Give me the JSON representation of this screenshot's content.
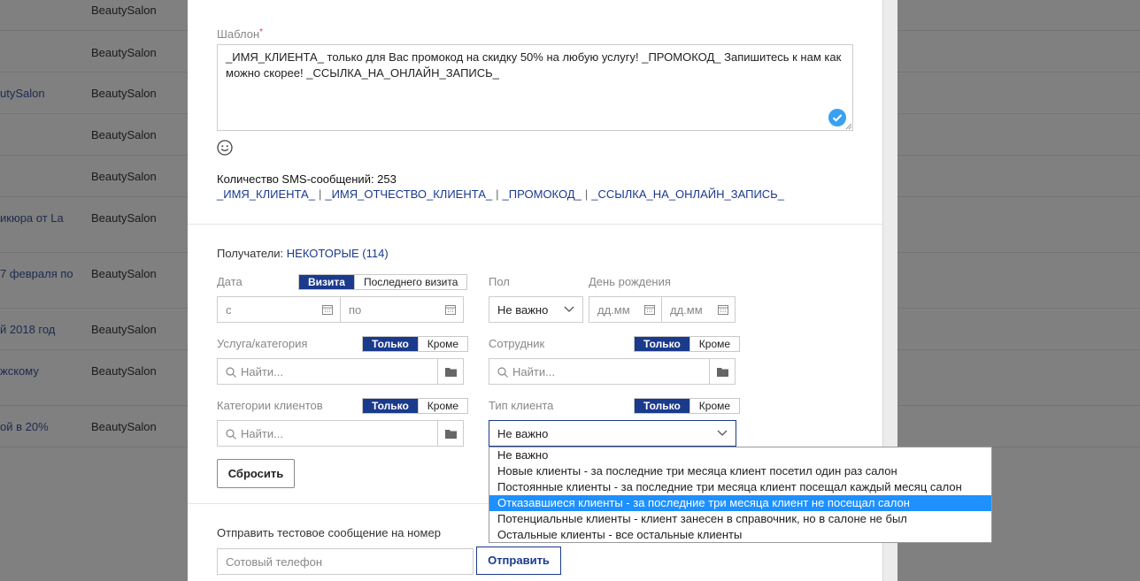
{
  "background_list": {
    "rows": [
      {
        "name": "",
        "salon": "BeautySalon"
      },
      {
        "name": "",
        "salon": "BeautySalon"
      },
      {
        "name": "utySalon",
        "salon": "BeautySalon"
      },
      {
        "name": "",
        "salon": "BeautySalon"
      },
      {
        "name": "",
        "salon": "BeautySalon"
      },
      {
        "name": "икюра от La",
        "salon": "BeautySalon"
      },
      {
        "name": "7 февраля по",
        "salon": "BeautySalon"
      },
      {
        "name": "й 2018 год",
        "salon": "BeautySalon"
      },
      {
        "name": "жскому",
        "salon": "BeautySalon"
      },
      {
        "name": "ой в 20%",
        "salon": "BeautySalon"
      }
    ]
  },
  "template": {
    "label": "Шаблон",
    "text": "_ИМЯ_КЛИЕНТА_ только для Вас промокод на скидку 50% на любую услугу! _ПРОМОКОД_ Запишитесь к нам как можно скорее! _ССЫЛКА_НА_ОНЛАЙН_ЗАПИСЬ_",
    "sms_count": "Количество SMS-сообщений: 253",
    "variables": [
      "_ИМЯ_КЛИЕНТА_",
      "_ИМЯ_ОТЧЕСТВО_КЛИЕНТА_",
      "_ПРОМОКОД_",
      "_ССЫЛКА_НА_ОНЛАЙН_ЗАПИСЬ_"
    ],
    "separator": "|"
  },
  "recipients": {
    "label": "Получатели:",
    "value": "НЕКОТОРЫЕ (114)"
  },
  "filters": {
    "date": {
      "label": "Дата",
      "toggle": [
        "Визита",
        "Последнего визита"
      ],
      "from_placeholder": "с",
      "to_placeholder": "по"
    },
    "gender": {
      "label": "Пол",
      "value": "Не важно"
    },
    "birthday": {
      "label": "День рождения",
      "from_placeholder": "дд.мм",
      "to_placeholder": "дд.мм"
    },
    "service": {
      "label": "Услуга/категория",
      "toggle": [
        "Только",
        "Кроме"
      ],
      "placeholder": "Найти..."
    },
    "employee": {
      "label": "Сотрудник",
      "toggle": [
        "Только",
        "Кроме"
      ],
      "placeholder": "Найти..."
    },
    "client_categories": {
      "label": "Категории клиентов",
      "toggle": [
        "Только",
        "Кроме"
      ],
      "placeholder": "Найти..."
    },
    "client_type": {
      "label": "Тип клиента",
      "toggle": [
        "Только",
        "Кроме"
      ],
      "value": "Не важно",
      "options": [
        "Не важно",
        "Новые клиенты - за последние три месяца клиент посетил один раз салон",
        "Постоянные клиенты - за последние три месяца клиент посещал каждый месяц салон",
        "Отказавшиеся клиенты - за последние три месяца клиент не посещал салон",
        "Потенциальные клиенты - клиент занесен в справочник, но в салоне не был",
        "Остальные клиенты - все остальные клиенты"
      ],
      "highlighted_index": 3
    }
  },
  "actions": {
    "reset": "Сбросить"
  },
  "test_message": {
    "label": "Отправить тестовое сообщение на номер",
    "placeholder": "Сотовый телефон",
    "send": "Отправить"
  },
  "colors": {
    "accent": "#1a3a8c",
    "highlight": "#1e90ff",
    "overlay": "#808080"
  }
}
